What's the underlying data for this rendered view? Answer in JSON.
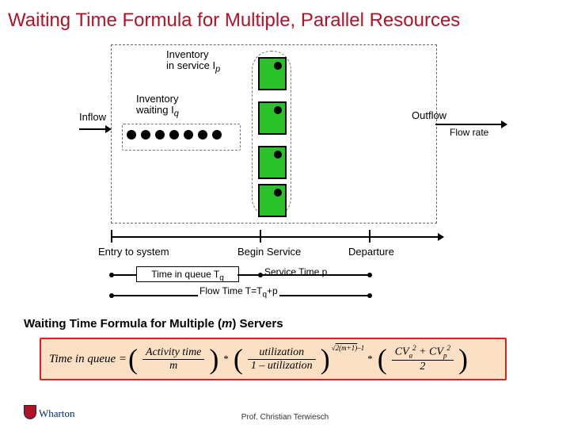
{
  "title": "Waiting Time Formula for Multiple, Parallel Resources",
  "diagram": {
    "inventory_service": "Inventory\nin service I",
    "inventory_service_sub": "p",
    "inventory_waiting": "Inventory\nwaiting I",
    "inventory_waiting_sub": "q",
    "inflow": "Inflow",
    "outflow": "Outflow",
    "flow_rate": "Flow rate"
  },
  "axis": {
    "entry": "Entry to system",
    "begin": "Begin Service",
    "depart": "Departure",
    "time_in_queue": "Time in queue T",
    "time_in_queue_sub": "q",
    "service_time": "Service Time p",
    "flow_time": "Flow Time T=T",
    "flow_time_sub": "q",
    "flow_time_tail": "+p"
  },
  "formula": {
    "header_a": "Waiting Time Formula for Multiple (",
    "header_m": "m",
    "header_b": ") Servers",
    "lead": "Time in queue =",
    "f1_top": "Activity time",
    "f1_bot": "m",
    "star": "*",
    "f2_top": "utilization",
    "f2_bot": "1 – utilization",
    "exp_a": "√",
    "exp_b": "2(m+1)",
    "exp_c": "–1",
    "f3_top_a": "CV",
    "f3_top_a_sub": "a",
    "f3_top_a_sup": "2",
    "f3_top_plus": " + CV",
    "f3_top_b_sub": "p",
    "f3_top_b_sup": "2",
    "f3_bot": "2"
  },
  "footer": {
    "logo": "Wharton",
    "credit": "Prof. Christian Terwiesch"
  }
}
